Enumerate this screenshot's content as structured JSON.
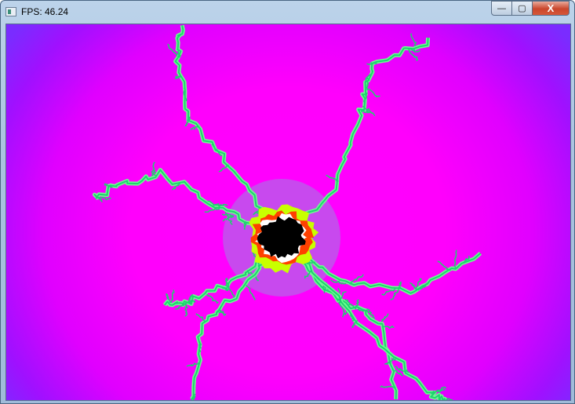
{
  "window": {
    "title": "FPS: 46.24",
    "icon": "app-window-icon"
  },
  "controls": {
    "minimize": "—",
    "maximize": "▢",
    "close": "X"
  },
  "colors": {
    "background": "#ff00ff",
    "edge": "#7a2cff",
    "arm": "#20d070",
    "glow": "#c8ff00",
    "core": "#000000",
    "rim": "#ff4000"
  }
}
